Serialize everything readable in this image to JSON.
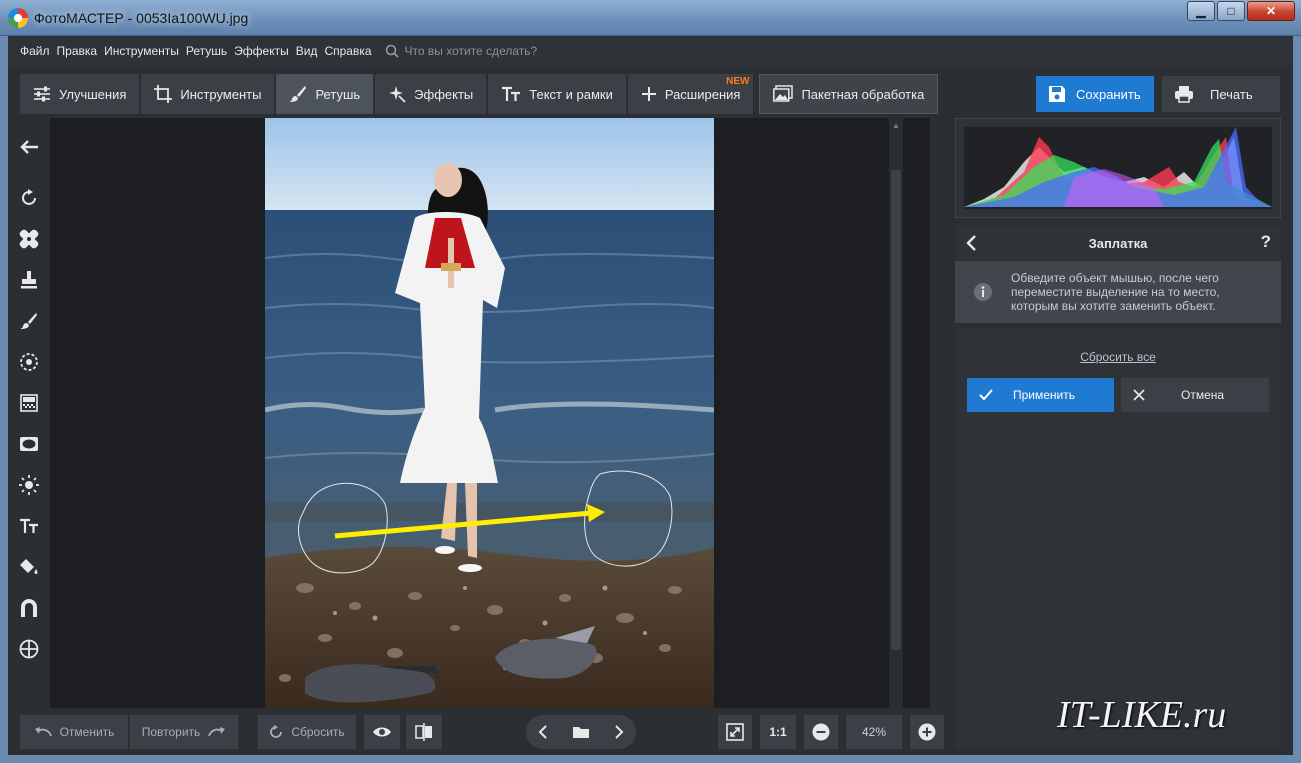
{
  "window": {
    "title": "ФотоМАСТЕР - 0053Ia100WU.jpg",
    "minimize": "▁",
    "maximize": "□",
    "close": "✕"
  },
  "menu": {
    "items": [
      "Файл",
      "Правка",
      "Инструменты",
      "Ретушь",
      "Эффекты",
      "Вид",
      "Справка"
    ],
    "search_placeholder": "Что вы хотите сделать?"
  },
  "toolbar": {
    "tabs": [
      {
        "label": "Улучшения",
        "icon": "sliders-icon"
      },
      {
        "label": "Инструменты",
        "icon": "crop-icon"
      },
      {
        "label": "Ретушь",
        "icon": "brush-icon",
        "active": true
      },
      {
        "label": "Эффекты",
        "icon": "sparkle-icon"
      },
      {
        "label": "Текст и рамки",
        "icon": "text-icon"
      },
      {
        "label": "Расширения",
        "icon": "plus-icon",
        "badge": "NEW"
      },
      {
        "label": "Пакетная обработка",
        "icon": "images-icon"
      }
    ],
    "save_label": "Сохранить",
    "print_label": "Печать"
  },
  "left_tools": [
    "back-arrow-icon",
    "rotate-icon",
    "bandage-icon",
    "stamp-icon",
    "brush-icon",
    "radial-icon",
    "gradient-icon",
    "vignette-icon",
    "sun-icon",
    "text-icon",
    "fill-icon",
    "magnet-icon",
    "target-icon"
  ],
  "panel": {
    "title": "Заплатка",
    "help": "?",
    "info": "Обведите объект мышью, после чего переместите выделение на то место, которым вы хотите заменить объект.",
    "reset_all": "Сбросить все",
    "apply": "Применить",
    "cancel": "Отмена"
  },
  "bottom": {
    "undo": "Отменить",
    "redo": "Повторить",
    "reset": "Сбросить",
    "ratio": "1:1",
    "zoom": "42%"
  },
  "watermark": "IT-LIKE.ru",
  "colors": {
    "accent": "#1f7ad1",
    "badge": "#ff7a1a",
    "arrow": "#ffee00"
  }
}
